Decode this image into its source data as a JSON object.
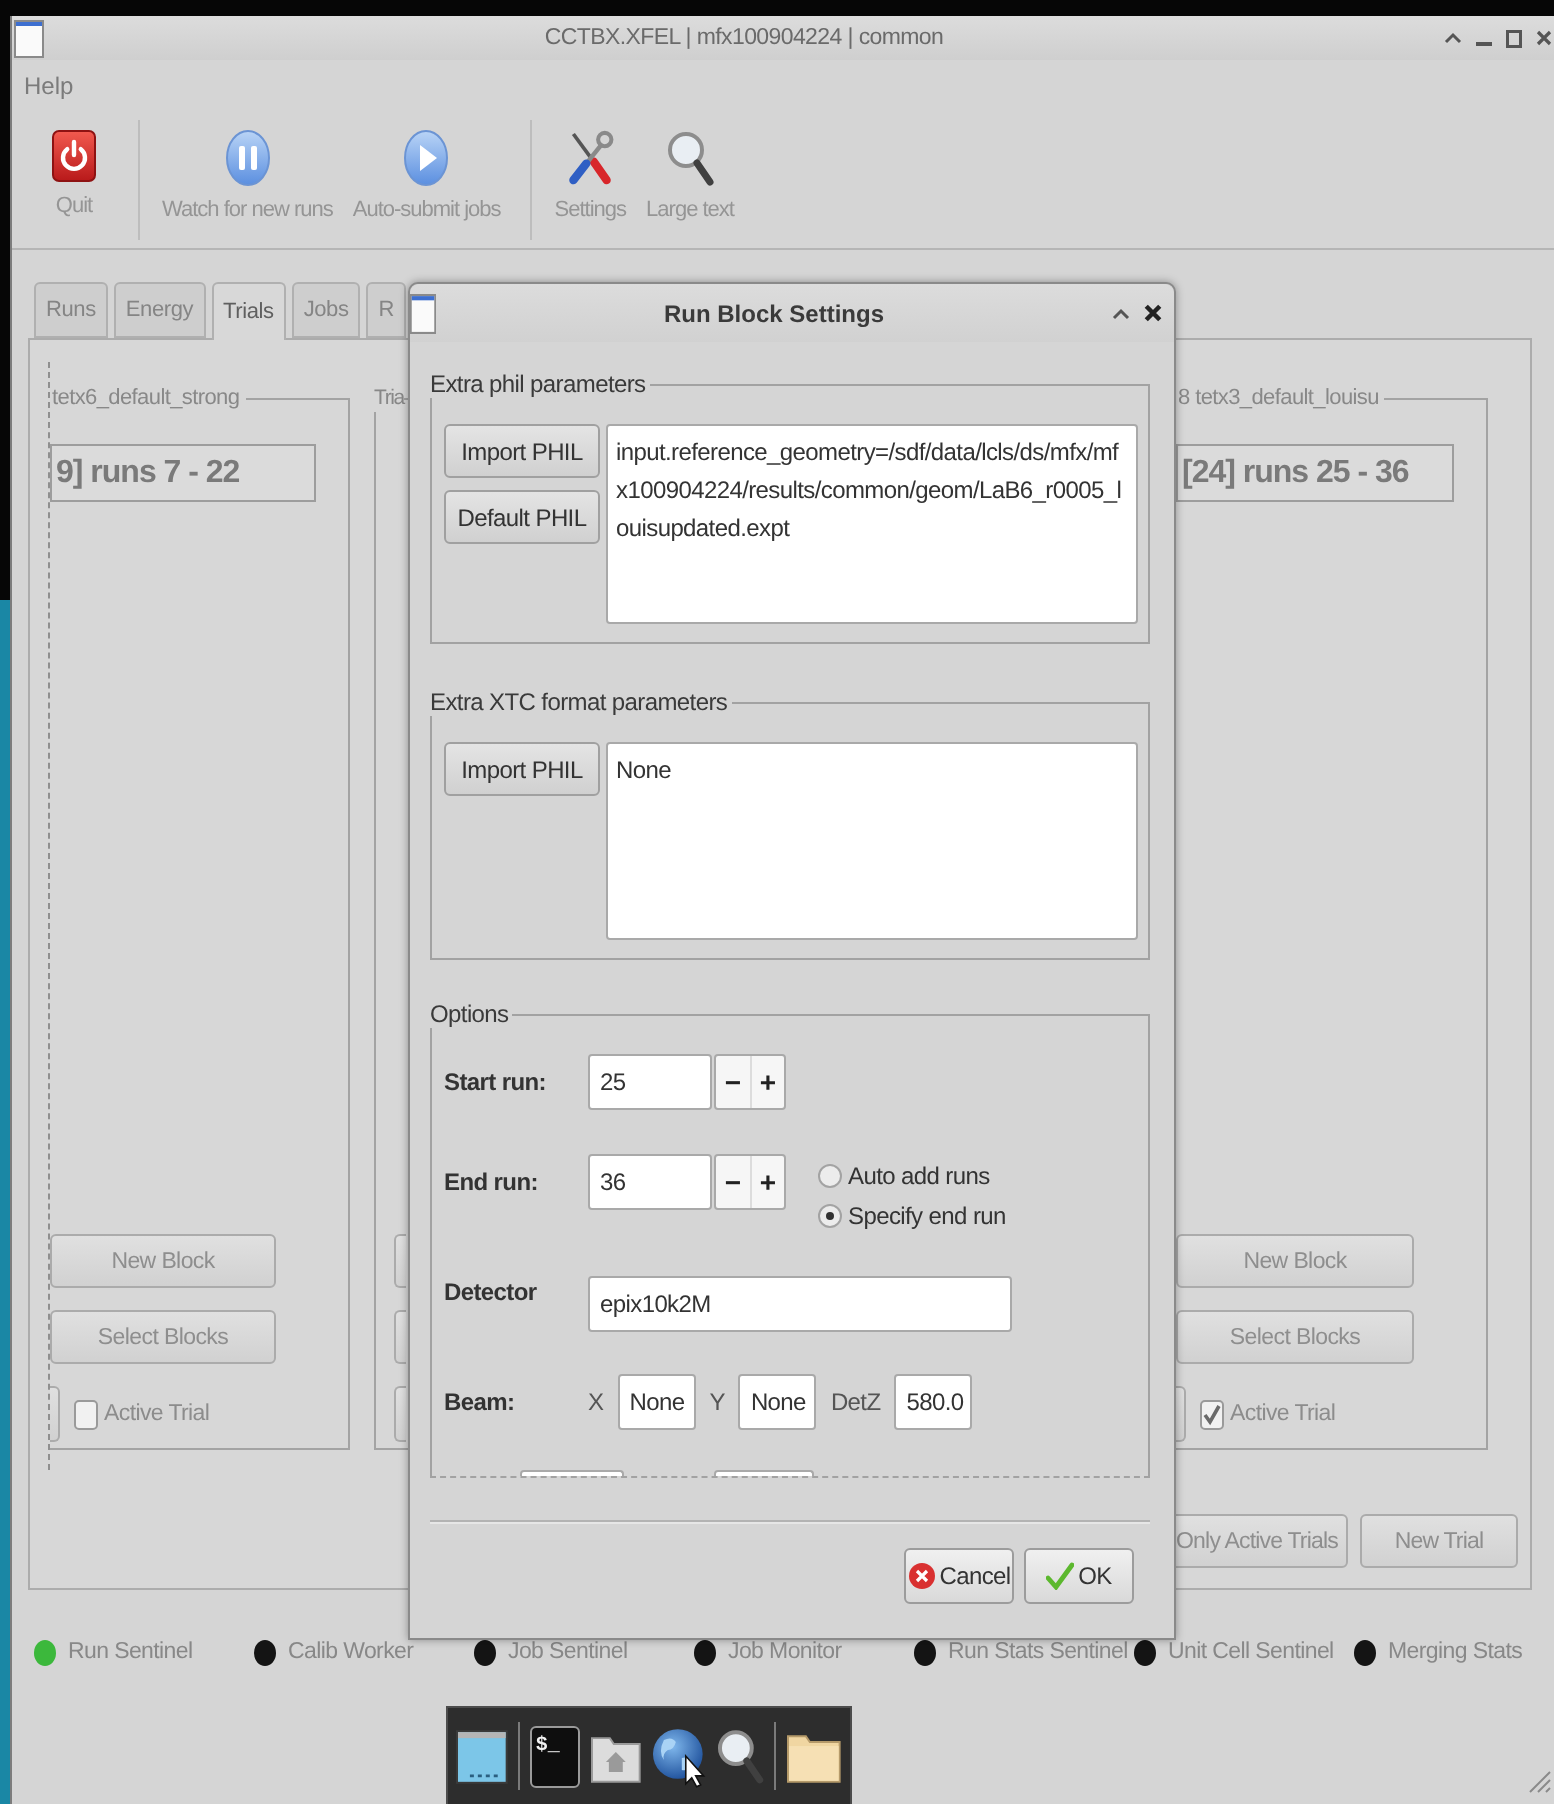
{
  "window": {
    "title": "CCTBX.XFEL | mfx100904224 | common"
  },
  "menu": [
    {
      "label": "Help"
    }
  ],
  "toolbar": [
    {
      "kind": "quit",
      "label": "Quit"
    },
    {
      "kind": "separator"
    },
    {
      "kind": "pause",
      "label": "Watch for new runs"
    },
    {
      "kind": "play",
      "label": "Auto-submit jobs"
    },
    {
      "kind": "separator"
    },
    {
      "kind": "tools",
      "label": "Settings"
    },
    {
      "kind": "magnifier",
      "label": "Large text"
    }
  ],
  "tabs": [
    {
      "label": "Runs",
      "selected": false
    },
    {
      "label": "Energy",
      "selected": false
    },
    {
      "label": "Trials",
      "selected": true
    },
    {
      "label": "Jobs",
      "selected": false
    },
    {
      "label": "R",
      "selected": false
    }
  ],
  "trials": {
    "columns": [
      {
        "kind": "panel",
        "legend": "tetx6_default_strong",
        "block": "9] runs 7 - 22",
        "buttons": [
          "New Block",
          "Select Blocks"
        ],
        "active_trial": {
          "label": "Active Trial",
          "checked": false
        }
      },
      {
        "kind": "sliver",
        "legend": "Tria"
      },
      {
        "kind": "panel",
        "legend": "8 tetx3_default_louisu",
        "block": "[24] runs 25 - 36",
        "buttons": [
          "New Block",
          "Select Blocks"
        ],
        "active_trial": {
          "label": "Active Trial",
          "checked": true
        }
      }
    ],
    "buttons": [
      "Only Active Trials",
      "New Trial"
    ]
  },
  "sentinels": [
    {
      "label": "Run Sentinel",
      "color": "#3cb83c"
    },
    {
      "label": "Calib Worker",
      "color": "#141414"
    },
    {
      "label": "Job Sentinel",
      "color": "#141414"
    },
    {
      "label": "Job Monitor",
      "color": "#141414"
    },
    {
      "label": "Run Stats Sentinel",
      "color": "#141414"
    },
    {
      "label": "Unit Cell Sentinel",
      "color": "#141414"
    },
    {
      "label": "Merging Stats",
      "color": "#141414"
    }
  ],
  "dock": [
    {
      "kind": "desktop"
    },
    {
      "kind": "separator"
    },
    {
      "kind": "terminal",
      "glyph": "$_"
    },
    {
      "kind": "home"
    },
    {
      "kind": "browser"
    },
    {
      "kind": "search"
    },
    {
      "kind": "separator"
    },
    {
      "kind": "folder"
    }
  ],
  "dialog": {
    "title": "Run Block Settings",
    "groups": [
      {
        "legend": "Extra phil parameters",
        "buttons": [
          "Import PHIL",
          "Default PHIL"
        ],
        "text": "input.reference_geometry=/sdf/data/lcls/ds/mfx/mfx100904224/results/common/geom/LaB6_r0005_louisupdated.expt"
      },
      {
        "legend": "Extra XTC format parameters",
        "buttons": [
          "Import PHIL"
        ],
        "text": "None"
      }
    ],
    "options": {
      "legend": "Options",
      "start_run": {
        "label": "Start run:",
        "value": "25",
        "decrement": "−",
        "increment": "+"
      },
      "end_run": {
        "label": "End run:",
        "value": "36",
        "decrement": "−",
        "increment": "+"
      },
      "end_mode": [
        {
          "label": "Auto add runs",
          "selected": false
        },
        {
          "label": "Specify end run",
          "selected": true
        }
      ],
      "detector": {
        "label": "Detector",
        "value": "epix10k2M"
      },
      "beam": {
        "label": "Beam:",
        "fields": [
          {
            "label": "X",
            "value": "None"
          },
          {
            "label": "Y",
            "value": "None"
          },
          {
            "label": "DetZ",
            "value": "580.0"
          }
        ]
      }
    },
    "buttons": [
      {
        "kind": "cancel",
        "label": "Cancel"
      },
      {
        "kind": "ok",
        "label": "OK"
      }
    ]
  }
}
